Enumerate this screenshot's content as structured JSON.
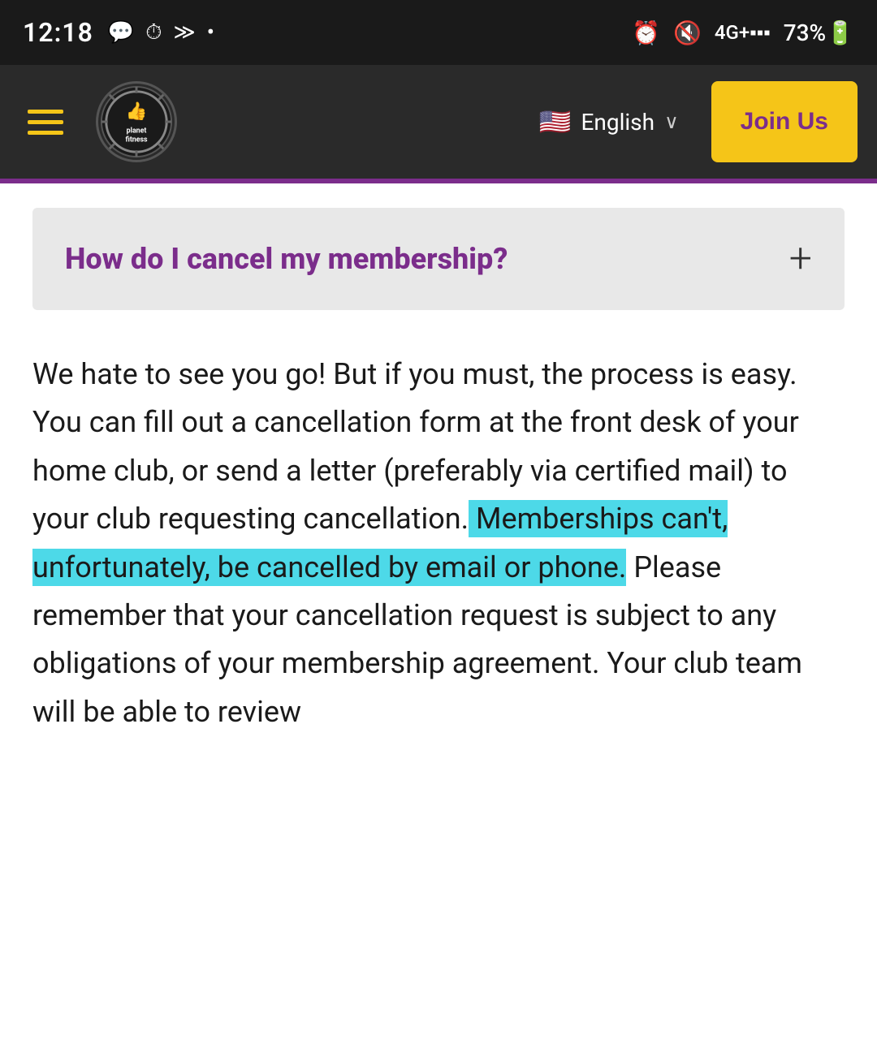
{
  "statusBar": {
    "time": "12:18",
    "leftIcons": [
      "💬",
      "⏱",
      "»",
      "•"
    ],
    "rightIcons": [
      "🔔",
      "🔇",
      "4G+",
      "73%",
      "🔋"
    ]
  },
  "navbar": {
    "logoAlt": "Planet Fitness Logo",
    "language": "English",
    "joinUsLabel": "Join Us"
  },
  "faq": {
    "question": "How do I cancel my membership?",
    "plusIcon": "+"
  },
  "content": {
    "paragraphPart1": "We hate to see you go! But if you must, the process is easy. You can fill out a cancellation form at the front desk of your home club, or send a letter (preferably via certified mail) to your club requesting cancellation.",
    "highlightedText": " Memberships can't, unfortunately, be cancelled by email or phone.",
    "paragraphPart2": " Please remember that your cancellation request is subject to any obligations of your membership agreement. Your club team will be able to review"
  }
}
